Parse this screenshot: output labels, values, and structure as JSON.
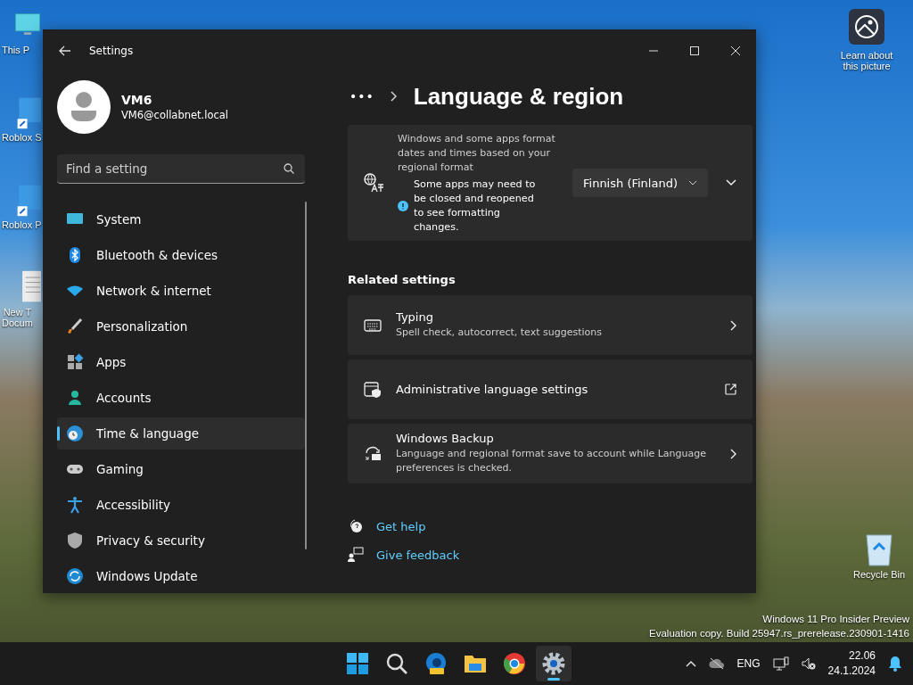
{
  "desktop": {
    "icons": [
      {
        "label": "This P"
      },
      {
        "label": "Roblox S"
      },
      {
        "label": "Roblox P"
      },
      {
        "label": "New T\nDocum"
      }
    ],
    "spotlight": {
      "label": "Learn about this picture"
    },
    "recycle_bin": {
      "label": "Recycle Bin"
    },
    "watermark": [
      "Windows 11 Pro Insider Preview",
      "Evaluation copy. Build 25947.rs_prerelease.230901-1416"
    ]
  },
  "window": {
    "title": "Settings",
    "user": {
      "name": "VM6",
      "email": "VM6@collabnet.local"
    },
    "search": {
      "placeholder": "Find a setting"
    },
    "nav": [
      {
        "label": "System",
        "selected": false
      },
      {
        "label": "Bluetooth & devices",
        "selected": false
      },
      {
        "label": "Network & internet",
        "selected": false
      },
      {
        "label": "Personalization",
        "selected": false
      },
      {
        "label": "Apps",
        "selected": false
      },
      {
        "label": "Accounts",
        "selected": false
      },
      {
        "label": "Time & language",
        "selected": true
      },
      {
        "label": "Gaming",
        "selected": false
      },
      {
        "label": "Accessibility",
        "selected": false
      },
      {
        "label": "Privacy & security",
        "selected": false
      },
      {
        "label": "Windows Update",
        "selected": false
      }
    ],
    "breadcrumb": {
      "more": "•••",
      "title": "Language & region"
    },
    "regional_format": {
      "description": "Windows and some apps format dates and times based on your regional format",
      "note": "Some apps may need to be closed and reopened to see formatting changes.",
      "value": "Finnish (Finland)",
      "expanded": false
    },
    "related_heading": "Related settings",
    "related": [
      {
        "kind": "link",
        "title": "Typing",
        "subtitle": "Spell check, autocorrect, text suggestions"
      },
      {
        "kind": "external",
        "title": "Administrative language settings"
      },
      {
        "kind": "link",
        "title": "Windows Backup",
        "subtitle": "Language and regional format save to account while Language preferences is checked."
      }
    ],
    "help": [
      {
        "label": "Get help"
      },
      {
        "label": "Give feedback"
      }
    ]
  },
  "taskbar": {
    "apps": [
      {
        "selected": false
      },
      {
        "selected": false
      },
      {
        "selected": false
      },
      {
        "selected": false
      },
      {
        "selected": false
      },
      {
        "selected": true
      }
    ],
    "language": "ENG",
    "time": "22.06",
    "date": "24.1.2024"
  }
}
